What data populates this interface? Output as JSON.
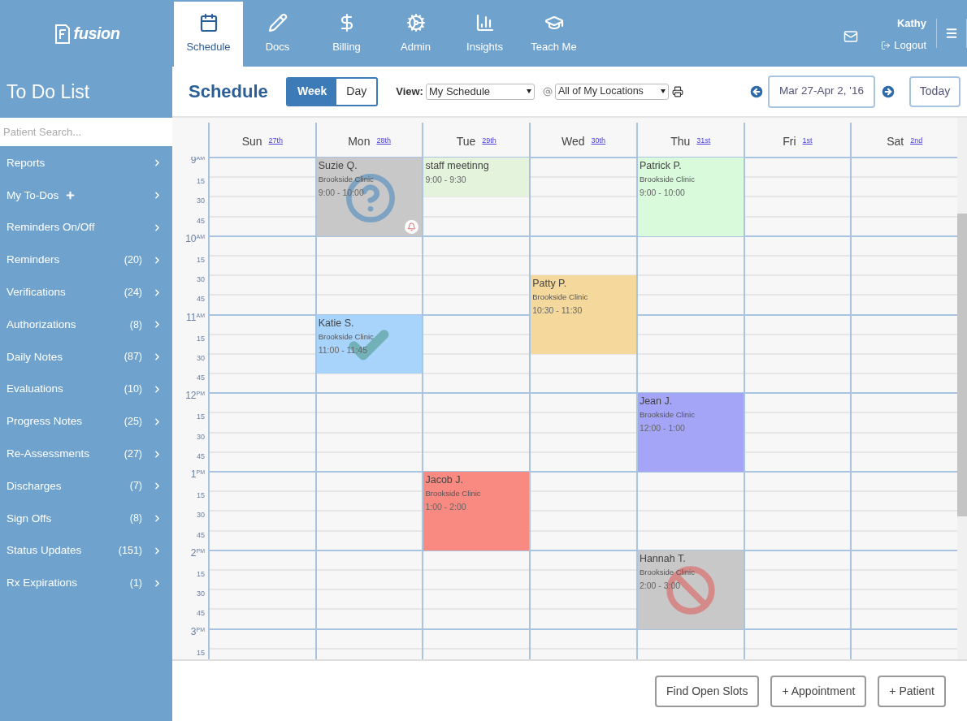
{
  "brand": {
    "name": "fusion"
  },
  "nav_tabs": [
    {
      "label": "Schedule",
      "selected": true
    },
    {
      "label": "Docs",
      "selected": false
    },
    {
      "label": "Billing",
      "selected": false
    },
    {
      "label": "Admin",
      "selected": false
    },
    {
      "label": "Insights",
      "selected": false
    },
    {
      "label": "Teach Me",
      "selected": false
    }
  ],
  "user": {
    "name": "Kathy",
    "logout": "Logout"
  },
  "sidebar": {
    "title": "To Do List",
    "search": {
      "placeholder": "Patient Search..."
    },
    "items": [
      {
        "label": "Reports"
      },
      {
        "label": "My To-Dos",
        "add": true
      },
      {
        "label": "Reminders On/Off"
      },
      {
        "label": "Reminders",
        "count": "(20)"
      },
      {
        "label": "Verifications",
        "count": "(24)"
      },
      {
        "label": "Authorizations",
        "count": "(8)"
      },
      {
        "label": "Daily Notes",
        "count": "(87)"
      },
      {
        "label": "Evaluations",
        "count": "(10)"
      },
      {
        "label": "Progress Notes",
        "count": "(25)"
      },
      {
        "label": "Re-Assessments",
        "count": "(27)"
      },
      {
        "label": "Discharges",
        "count": "(7)"
      },
      {
        "label": "Sign Offs",
        "count": "(8)"
      },
      {
        "label": "Status Updates",
        "count": "(151)"
      },
      {
        "label": "Rx Expirations",
        "count": "(1)"
      }
    ]
  },
  "toolbar": {
    "title": "Schedule",
    "range_toggle": [
      {
        "label": "Week",
        "selected": true
      },
      {
        "label": "Day",
        "selected": false
      }
    ],
    "view_label": "View:",
    "view_value": "My Schedule",
    "location_value": "All of My Locations",
    "date_range": "Mar 27-Apr 2, '16",
    "today": "Today"
  },
  "time_slots": [
    {
      "kind": "hour",
      "label": "9",
      "suffix": "AM"
    },
    {
      "kind": "quarter",
      "label": "15"
    },
    {
      "kind": "quarter",
      "label": "30"
    },
    {
      "kind": "quarter",
      "label": "45"
    },
    {
      "kind": "hour",
      "label": "10",
      "suffix": "AM"
    },
    {
      "kind": "quarter",
      "label": "15"
    },
    {
      "kind": "quarter",
      "label": "30"
    },
    {
      "kind": "quarter",
      "label": "45"
    },
    {
      "kind": "hour",
      "label": "11",
      "suffix": "AM"
    },
    {
      "kind": "quarter",
      "label": "15"
    },
    {
      "kind": "quarter",
      "label": "30"
    },
    {
      "kind": "quarter",
      "label": "45"
    },
    {
      "kind": "hour",
      "label": "12",
      "suffix": "PM"
    },
    {
      "kind": "quarter",
      "label": "15"
    },
    {
      "kind": "quarter",
      "label": "30"
    },
    {
      "kind": "quarter",
      "label": "45"
    },
    {
      "kind": "hour",
      "label": "1",
      "suffix": "PM"
    },
    {
      "kind": "quarter",
      "label": "15"
    },
    {
      "kind": "quarter",
      "label": "30"
    },
    {
      "kind": "quarter",
      "label": "45"
    },
    {
      "kind": "hour",
      "label": "2",
      "suffix": "PM"
    },
    {
      "kind": "quarter",
      "label": "15"
    },
    {
      "kind": "quarter",
      "label": "30"
    },
    {
      "kind": "quarter",
      "label": "45"
    },
    {
      "kind": "hour",
      "label": "3",
      "suffix": "PM"
    },
    {
      "kind": "quarter",
      "label": "15"
    }
  ],
  "days": [
    {
      "name": "Sun",
      "date": "27th"
    },
    {
      "name": "Mon",
      "date": "28th",
      "events": [
        {
          "title": "Suzie Q.",
          "location": "Brookside Clinic",
          "time": "9:00 - 10:00",
          "color": "#c8c8c8",
          "kind": "question",
          "alarm": true
        },
        {
          "title": "Katie S.",
          "location": "Brookside Clinic",
          "time": "11:00 - 11:45",
          "color": "#a8d4fb",
          "kind": "check"
        }
      ]
    },
    {
      "name": "Tue",
      "date": "29th",
      "events": [
        {
          "title": "staff meetinng",
          "time": "9:00 - 9:30",
          "color": "#e4f4dc"
        },
        {
          "title": "Jacob J.",
          "location": "Brookside Clinic",
          "time": "1:00 - 2:00",
          "color": "#f98a82"
        }
      ]
    },
    {
      "name": "Wed",
      "date": "30th",
      "events": [
        {
          "title": "Patty P.",
          "location": "Brookside Clinic",
          "time": "10:30 - 11:30",
          "color": "#f4d89c"
        }
      ]
    },
    {
      "name": "Thu",
      "date": "31st",
      "events": [
        {
          "title": "Patrick P.",
          "location": "Brookside Clinic",
          "time": "9:00 - 10:00",
          "color": "#d9fbdc"
        },
        {
          "title": "Jean J.",
          "location": "Brookside Clinic",
          "time": "12:00 - 1:00",
          "color": "#a5a5f8"
        },
        {
          "title": "Hannah T.",
          "location": "Brookside Clinic",
          "time": "2:00 - 3:00",
          "color": "#c8c8c8",
          "kind": "blocked"
        }
      ]
    },
    {
      "name": "Fri",
      "date": "1st"
    },
    {
      "name": "Sat",
      "date": "2nd"
    }
  ],
  "footer_buttons": [
    "Find Open Slots",
    "+ Appointment",
    "+ Patient"
  ]
}
